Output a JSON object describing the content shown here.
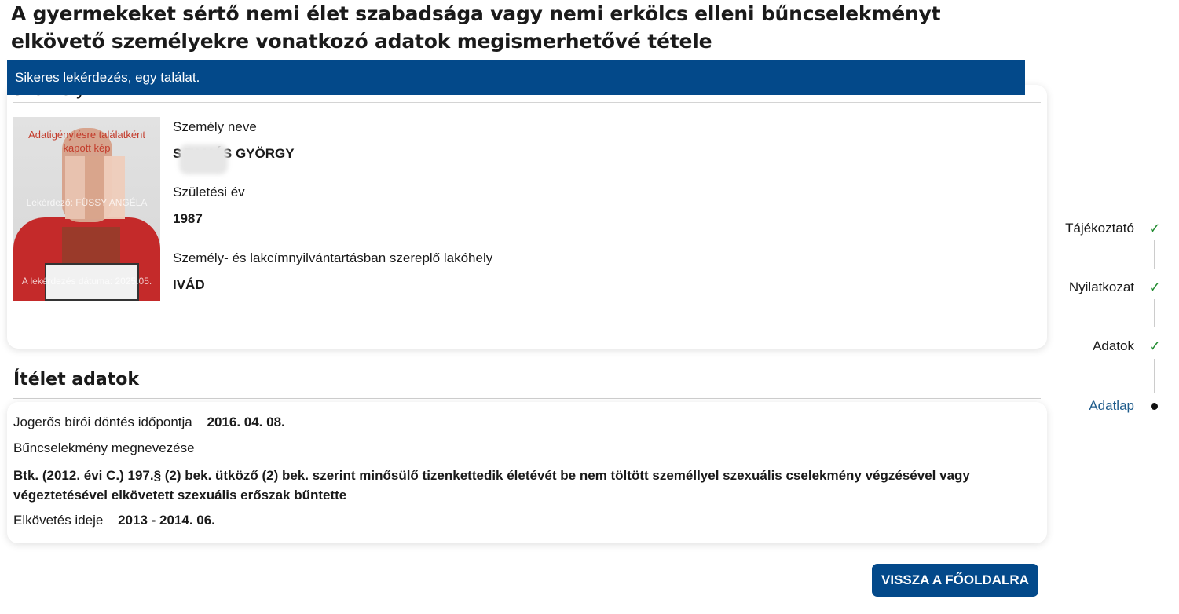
{
  "page": {
    "title": "A gyermekeket sértő nemi élet szabadsága vagy nemi erkölcs elleni bűncselekményt elkövető személyekre vonatkozó adatok megismerhetővé tétele"
  },
  "banner": {
    "message": "Sikeres lekérdezés, egy találat."
  },
  "person": {
    "heading_partial": "Személy",
    "photo_watermark_top": "Adatigénylésre találatként kapott kép",
    "photo_watermark_mid": "Lekérdező: FÜSSY ANGÉLA",
    "photo_watermark_bottom": "A lekérdezés dátuma: 2025.05.",
    "fields": [
      {
        "label": "Személy neve",
        "value": "S TAMÁS GYÖRGY"
      },
      {
        "label": "Születési év",
        "value": "1987"
      },
      {
        "label": "Személy- és lakcímnyilvántartásban szereplő lakóhely",
        "value": "IVÁD"
      }
    ]
  },
  "verdict": {
    "section_title": "Ítélet adatok",
    "decision_label": "Jogerős bírói döntés időpontja",
    "decision_value": "2016. 04. 08.",
    "crime_label": "Bűncselekmény megnevezése",
    "crime_value": "Btk. (2012. évi C.) 197.§ (2) bek. ütköző (2) bek. szerint minősülő tizenkettedik életévét be nem töltött személlyel szexuális cselekmény végzésével vagy végeztetésével elkövetett szexuális erőszak bűntette",
    "period_label": "Elkövetés ideje",
    "period_value": "2013 - 2014. 06."
  },
  "buttons": {
    "back_label": "VISSZA A FŐOLDALRA"
  },
  "stepper": {
    "steps": [
      {
        "label": "Tájékoztató",
        "state": "done",
        "icon": "check-icon"
      },
      {
        "label": "Nyilatkozat",
        "state": "done",
        "icon": "check-icon"
      },
      {
        "label": "Adatok",
        "state": "done",
        "icon": "check-icon"
      },
      {
        "label": "Adatlap",
        "state": "current",
        "icon": "dot-icon"
      }
    ],
    "colors": {
      "done": "#1f8a2e",
      "current": "#1f5c8c",
      "accent": "#03498a"
    }
  }
}
